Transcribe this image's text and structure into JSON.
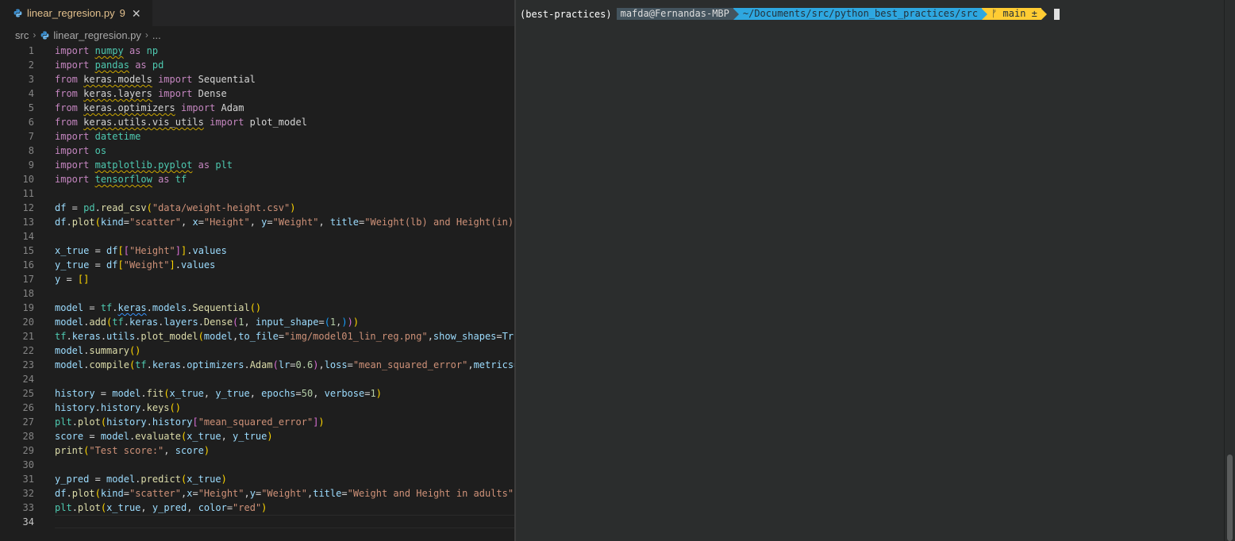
{
  "editor": {
    "tab": {
      "label": "linear_regresion.py",
      "badge": "9",
      "close": "✕"
    },
    "breadcrumb": {
      "folder": "src",
      "file": "linear_regresion.py",
      "more": "..."
    },
    "active_line": 34,
    "lines": [
      {
        "n": "1"
      },
      {
        "n": "2"
      },
      {
        "n": "3"
      },
      {
        "n": "4"
      },
      {
        "n": "5"
      },
      {
        "n": "6"
      },
      {
        "n": "7"
      },
      {
        "n": "8"
      },
      {
        "n": "9"
      },
      {
        "n": "10"
      },
      {
        "n": "11"
      },
      {
        "n": "12"
      },
      {
        "n": "13"
      },
      {
        "n": "14"
      },
      {
        "n": "15"
      },
      {
        "n": "16"
      },
      {
        "n": "17"
      },
      {
        "n": "18"
      },
      {
        "n": "19"
      },
      {
        "n": "20"
      },
      {
        "n": "21"
      },
      {
        "n": "22"
      },
      {
        "n": "23"
      },
      {
        "n": "24"
      },
      {
        "n": "25"
      },
      {
        "n": "26"
      },
      {
        "n": "27"
      },
      {
        "n": "28"
      },
      {
        "n": "29"
      },
      {
        "n": "30"
      },
      {
        "n": "31"
      },
      {
        "n": "32"
      },
      {
        "n": "33"
      },
      {
        "n": "34"
      }
    ],
    "code": [
      [
        [
          "k",
          "import"
        ],
        [
          "i",
          " "
        ],
        [
          "m",
          "numpy",
          "w"
        ],
        [
          "i",
          " "
        ],
        [
          "k",
          "as"
        ],
        [
          "i",
          " "
        ],
        [
          "m",
          "np"
        ]
      ],
      [
        [
          "k",
          "import"
        ],
        [
          "i",
          " "
        ],
        [
          "m",
          "pandas",
          "w"
        ],
        [
          "i",
          " "
        ],
        [
          "k",
          "as"
        ],
        [
          "i",
          " "
        ],
        [
          "m",
          "pd"
        ]
      ],
      [
        [
          "k",
          "from"
        ],
        [
          "i",
          " "
        ],
        [
          "i",
          "keras.models",
          "w"
        ],
        [
          "i",
          " "
        ],
        [
          "k",
          "import"
        ],
        [
          "i",
          " Sequential"
        ]
      ],
      [
        [
          "k",
          "from"
        ],
        [
          "i",
          " "
        ],
        [
          "i",
          "keras.layers",
          "w"
        ],
        [
          "i",
          " "
        ],
        [
          "k",
          "import"
        ],
        [
          "i",
          " Dense"
        ]
      ],
      [
        [
          "k",
          "from"
        ],
        [
          "i",
          " "
        ],
        [
          "i",
          "keras.optimizers",
          "w"
        ],
        [
          "i",
          " "
        ],
        [
          "k",
          "import"
        ],
        [
          "i",
          " Adam"
        ]
      ],
      [
        [
          "k",
          "from"
        ],
        [
          "i",
          " "
        ],
        [
          "i",
          "keras.utils.vis_utils",
          "w"
        ],
        [
          "i",
          " "
        ],
        [
          "k",
          "import"
        ],
        [
          "i",
          " plot_model"
        ]
      ],
      [
        [
          "k",
          "import"
        ],
        [
          "i",
          " "
        ],
        [
          "m",
          "datetime"
        ]
      ],
      [
        [
          "k",
          "import"
        ],
        [
          "i",
          " "
        ],
        [
          "m",
          "os"
        ]
      ],
      [
        [
          "k",
          "import"
        ],
        [
          "i",
          " "
        ],
        [
          "m",
          "matplotlib.pyplot",
          "w"
        ],
        [
          "i",
          " "
        ],
        [
          "k",
          "as"
        ],
        [
          "i",
          " "
        ],
        [
          "m",
          "plt"
        ]
      ],
      [
        [
          "k",
          "import"
        ],
        [
          "i",
          " "
        ],
        [
          "m",
          "tensorflow",
          "w"
        ],
        [
          "i",
          " "
        ],
        [
          "k",
          "as"
        ],
        [
          "i",
          " "
        ],
        [
          "m",
          "tf"
        ]
      ],
      [],
      [
        [
          "v",
          "df"
        ],
        [
          "i",
          " = "
        ],
        [
          "m",
          "pd"
        ],
        [
          "i",
          "."
        ],
        [
          "f",
          "read_csv"
        ],
        [
          "b1",
          "("
        ],
        [
          "s",
          "\"data/weight-height.csv\""
        ],
        [
          "b1",
          ")"
        ]
      ],
      [
        [
          "v",
          "df"
        ],
        [
          "i",
          "."
        ],
        [
          "f",
          "plot"
        ],
        [
          "b1",
          "("
        ],
        [
          "v",
          "kind"
        ],
        [
          "i",
          "="
        ],
        [
          "s",
          "\"scatter\""
        ],
        [
          "i",
          ", "
        ],
        [
          "v",
          "x"
        ],
        [
          "i",
          "="
        ],
        [
          "s",
          "\"Height\""
        ],
        [
          "i",
          ", "
        ],
        [
          "v",
          "y"
        ],
        [
          "i",
          "="
        ],
        [
          "s",
          "\"Weight\""
        ],
        [
          "i",
          ", "
        ],
        [
          "v",
          "title"
        ],
        [
          "i",
          "="
        ],
        [
          "s",
          "\"Weight(lb) and Height(in)"
        ]
      ],
      [],
      [
        [
          "v",
          "x_true"
        ],
        [
          "i",
          " = "
        ],
        [
          "v",
          "df"
        ],
        [
          "b1",
          "["
        ],
        [
          "b2",
          "["
        ],
        [
          "s",
          "\"Height\""
        ],
        [
          "b2",
          "]"
        ],
        [
          "b1",
          "]"
        ],
        [
          "i",
          "."
        ],
        [
          "v",
          "values"
        ]
      ],
      [
        [
          "v",
          "y_true"
        ],
        [
          "i",
          " = "
        ],
        [
          "v",
          "df"
        ],
        [
          "b1",
          "["
        ],
        [
          "s",
          "\"Weight\""
        ],
        [
          "b1",
          "]"
        ],
        [
          "i",
          "."
        ],
        [
          "v",
          "values"
        ]
      ],
      [
        [
          "v",
          "y"
        ],
        [
          "i",
          " = "
        ],
        [
          "b1",
          "[]"
        ]
      ],
      [],
      [
        [
          "v",
          "model"
        ],
        [
          "i",
          " = "
        ],
        [
          "m",
          "tf"
        ],
        [
          "i",
          "."
        ],
        [
          "v",
          "keras",
          "wb"
        ],
        [
          "i",
          "."
        ],
        [
          "v",
          "models"
        ],
        [
          "i",
          "."
        ],
        [
          "f",
          "Sequential"
        ],
        [
          "b1",
          "()"
        ]
      ],
      [
        [
          "v",
          "model"
        ],
        [
          "i",
          "."
        ],
        [
          "f",
          "add"
        ],
        [
          "b1",
          "("
        ],
        [
          "m",
          "tf"
        ],
        [
          "i",
          "."
        ],
        [
          "v",
          "keras"
        ],
        [
          "i",
          "."
        ],
        [
          "v",
          "layers"
        ],
        [
          "i",
          "."
        ],
        [
          "f",
          "Dense"
        ],
        [
          "b2",
          "("
        ],
        [
          "n",
          "1"
        ],
        [
          "i",
          ", "
        ],
        [
          "v",
          "input_shape"
        ],
        [
          "i",
          "="
        ],
        [
          "b3",
          "("
        ],
        [
          "n",
          "1"
        ],
        [
          "i",
          ","
        ],
        [
          "b3",
          ")"
        ],
        [
          "b2",
          ")"
        ],
        [
          "b1",
          ")"
        ]
      ],
      [
        [
          "m",
          "tf"
        ],
        [
          "i",
          "."
        ],
        [
          "v",
          "keras"
        ],
        [
          "i",
          "."
        ],
        [
          "v",
          "utils"
        ],
        [
          "i",
          "."
        ],
        [
          "f",
          "plot_model"
        ],
        [
          "b1",
          "("
        ],
        [
          "v",
          "model"
        ],
        [
          "i",
          ","
        ],
        [
          "v",
          "to_file"
        ],
        [
          "i",
          "="
        ],
        [
          "s",
          "\"img/model01_lin_reg.png\""
        ],
        [
          "i",
          ","
        ],
        [
          "v",
          "show_shapes"
        ],
        [
          "i",
          "="
        ],
        [
          "v",
          "Tru"
        ]
      ],
      [
        [
          "v",
          "model"
        ],
        [
          "i",
          "."
        ],
        [
          "f",
          "summary"
        ],
        [
          "b1",
          "()"
        ]
      ],
      [
        [
          "v",
          "model"
        ],
        [
          "i",
          "."
        ],
        [
          "f",
          "compile"
        ],
        [
          "b1",
          "("
        ],
        [
          "m",
          "tf"
        ],
        [
          "i",
          "."
        ],
        [
          "v",
          "keras"
        ],
        [
          "i",
          "."
        ],
        [
          "v",
          "optimizers"
        ],
        [
          "i",
          "."
        ],
        [
          "f",
          "Adam"
        ],
        [
          "b2",
          "("
        ],
        [
          "v",
          "lr"
        ],
        [
          "i",
          "="
        ],
        [
          "n",
          "0.6"
        ],
        [
          "b2",
          ")"
        ],
        [
          "i",
          ","
        ],
        [
          "v",
          "loss"
        ],
        [
          "i",
          "="
        ],
        [
          "s",
          "\"mean_squared_error\""
        ],
        [
          "i",
          ","
        ],
        [
          "v",
          "metrics="
        ]
      ],
      [],
      [
        [
          "v",
          "history"
        ],
        [
          "i",
          " = "
        ],
        [
          "v",
          "model"
        ],
        [
          "i",
          "."
        ],
        [
          "f",
          "fit"
        ],
        [
          "b1",
          "("
        ],
        [
          "v",
          "x_true"
        ],
        [
          "i",
          ", "
        ],
        [
          "v",
          "y_true"
        ],
        [
          "i",
          ", "
        ],
        [
          "v",
          "epochs"
        ],
        [
          "i",
          "="
        ],
        [
          "n",
          "50"
        ],
        [
          "i",
          ", "
        ],
        [
          "v",
          "verbose"
        ],
        [
          "i",
          "="
        ],
        [
          "n",
          "1"
        ],
        [
          "b1",
          ")"
        ]
      ],
      [
        [
          "v",
          "history"
        ],
        [
          "i",
          "."
        ],
        [
          "v",
          "history"
        ],
        [
          "i",
          "."
        ],
        [
          "f",
          "keys"
        ],
        [
          "b1",
          "()"
        ]
      ],
      [
        [
          "m",
          "plt"
        ],
        [
          "i",
          "."
        ],
        [
          "f",
          "plot"
        ],
        [
          "b1",
          "("
        ],
        [
          "v",
          "history"
        ],
        [
          "i",
          "."
        ],
        [
          "v",
          "history"
        ],
        [
          "b2",
          "["
        ],
        [
          "s",
          "\"mean_squared_error\""
        ],
        [
          "b2",
          "]"
        ],
        [
          "b1",
          ")"
        ]
      ],
      [
        [
          "v",
          "score"
        ],
        [
          "i",
          " = "
        ],
        [
          "v",
          "model"
        ],
        [
          "i",
          "."
        ],
        [
          "f",
          "evaluate"
        ],
        [
          "b1",
          "("
        ],
        [
          "v",
          "x_true"
        ],
        [
          "i",
          ", "
        ],
        [
          "v",
          "y_true"
        ],
        [
          "b1",
          ")"
        ]
      ],
      [
        [
          "f",
          "print"
        ],
        [
          "b1",
          "("
        ],
        [
          "s",
          "\"Test score:\""
        ],
        [
          "i",
          ", "
        ],
        [
          "v",
          "score"
        ],
        [
          "b1",
          ")"
        ]
      ],
      [],
      [
        [
          "v",
          "y_pred"
        ],
        [
          "i",
          " = "
        ],
        [
          "v",
          "model"
        ],
        [
          "i",
          "."
        ],
        [
          "f",
          "predict"
        ],
        [
          "b1",
          "("
        ],
        [
          "v",
          "x_true"
        ],
        [
          "b1",
          ")"
        ]
      ],
      [
        [
          "v",
          "df"
        ],
        [
          "i",
          "."
        ],
        [
          "f",
          "plot"
        ],
        [
          "b1",
          "("
        ],
        [
          "v",
          "kind"
        ],
        [
          "i",
          "="
        ],
        [
          "s",
          "\"scatter\""
        ],
        [
          "i",
          ","
        ],
        [
          "v",
          "x"
        ],
        [
          "i",
          "="
        ],
        [
          "s",
          "\"Height\""
        ],
        [
          "i",
          ","
        ],
        [
          "v",
          "y"
        ],
        [
          "i",
          "="
        ],
        [
          "s",
          "\"Weight\""
        ],
        [
          "i",
          ","
        ],
        [
          "v",
          "title"
        ],
        [
          "i",
          "="
        ],
        [
          "s",
          "\"Weight and Height in adults\""
        ]
      ],
      [
        [
          "m",
          "plt"
        ],
        [
          "i",
          "."
        ],
        [
          "f",
          "plot"
        ],
        [
          "b1",
          "("
        ],
        [
          "v",
          "x_true"
        ],
        [
          "i",
          ", "
        ],
        [
          "v",
          "y_pred"
        ],
        [
          "i",
          ", "
        ],
        [
          "v",
          "color"
        ],
        [
          "i",
          "="
        ],
        [
          "s",
          "\"red\""
        ],
        [
          "b1",
          ")"
        ]
      ],
      []
    ]
  },
  "terminal": {
    "env": "(best-practices)",
    "user_host": "mafda@Fernandas-MBP",
    "path": "~/Documents/src/python_best_practices/src",
    "git": "ᚠ main ±"
  },
  "colors": {
    "editor_bg": "#1e1e1e",
    "terminal_bg": "#2b2d2d",
    "tab_modified": "#e2c08d",
    "keyword": "#c586c0",
    "module": "#4ec9b0",
    "variable": "#9cdcfe",
    "function": "#dcdcaa",
    "string": "#ce9178",
    "number": "#b5cea8",
    "prompt_user_bg": "#44545e",
    "prompt_path_bg": "#2ea7e0",
    "prompt_git_bg": "#ffcc33"
  }
}
